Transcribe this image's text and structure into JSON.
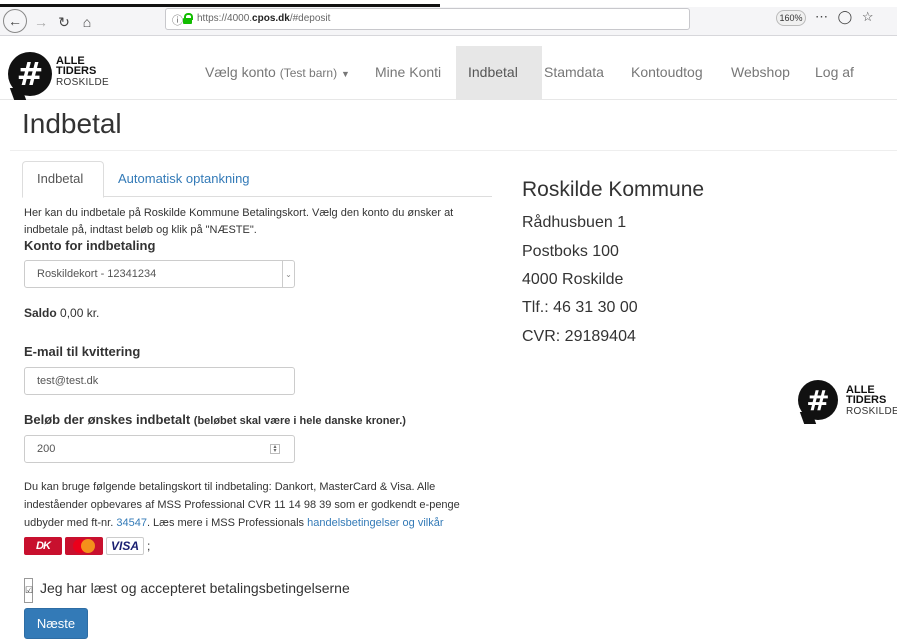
{
  "browser": {
    "url_prefix": "https://4000.",
    "url_domain": "cpos.dk",
    "url_suffix": "/#deposit",
    "zoom": "160%",
    "icons": [
      "back-icon",
      "forward-icon",
      "reload-icon",
      "home-icon",
      "info-icon",
      "lock-icon",
      "more-icon",
      "pocket-icon",
      "bookmark-star-icon"
    ]
  },
  "logo": {
    "line1": "ALLE",
    "line2": "TIDERS",
    "line3": "ROSKILDE"
  },
  "nav": {
    "choose_account": "Vælg konto",
    "choose_account_sub": "(Test barn)",
    "my_accounts": "Mine Konti",
    "deposit": "Indbetal",
    "master_data": "Stamdata",
    "statement": "Kontoudtog",
    "webshop": "Webshop",
    "logout": "Log af"
  },
  "page": {
    "title": "Indbetal",
    "tab_deposit": "Indbetal",
    "tab_auto": "Automatisk optankning",
    "intro": "Her kan du indbetale på Roskilde Kommune Betalingskort. Vælg den konto du ønsker at indbetale på, indtast beløb og klik på \"NÆSTE\".",
    "account_label": "Konto for indbetaling",
    "account_value": "Roskildekort - 12341234",
    "saldo_label": "Saldo",
    "saldo_value": "0,00 kr.",
    "email_label": "E-mail til kvittering",
    "email_value": "test@test.dk",
    "amount_label": "Beløb der ønskes indbetalt",
    "amount_hint": "(beløbet skal være i hele danske kroner.)",
    "amount_value": "200",
    "note_text": "Du kan bruge følgende betalingskort til indbetaling: Dankort, MasterCard & Visa. Alle indeståender opbevares af MSS Professional CVR 11 14 98 39 som er godkendt e-penge udbyder med ft-nr.",
    "note_ft_link": "34547",
    "note_more": ". Læs mere i MSS Professionals",
    "note_terms_link": "handelsbetingelser og vilkår",
    "card_dk": "DK",
    "card_visa": "VISA",
    "card_semicolon": ";",
    "accept_label": "Jeg har læst og accepteret betalingsbetingelserne",
    "next_button": "Næste"
  },
  "org": {
    "name": "Roskilde Kommune",
    "street": "Rådhusbuen 1",
    "pobox": "Postboks 100",
    "city": "4000 Roskilde",
    "phone": "Tlf.: 46 31 30 00",
    "cvr": "CVR: 29189404"
  }
}
